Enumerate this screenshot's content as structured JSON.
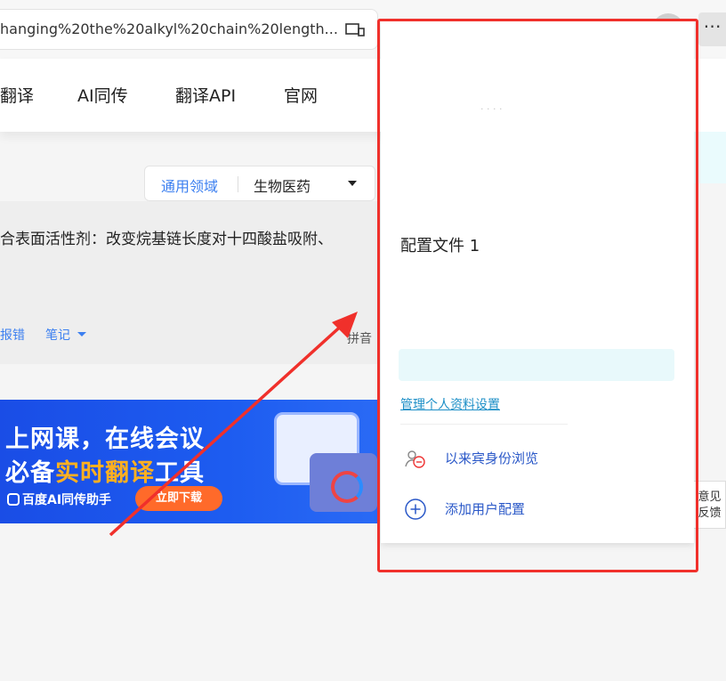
{
  "browser": {
    "url": "hanging%20the%20alkyl%20chain%20length..."
  },
  "site_nav": {
    "items": [
      "翻译",
      "AI同传",
      "翻译API",
      "官网"
    ]
  },
  "domain": {
    "general": "通用领域",
    "selected": "生物医药"
  },
  "source": {
    "text": "合表面活性剂：改变烷基链长度对十四酸盐吸附、",
    "report": "报错",
    "notes": "笔记",
    "pinyin": "拼音"
  },
  "banner": {
    "line1": "上网课，在线会议",
    "line2_pre": "必备",
    "line2_highlight": "实时翻译",
    "line2_post": "工具",
    "brand": "百度AI同传助手",
    "button": "立即下载"
  },
  "feedback": {
    "line1": "意见",
    "line2": "反馈"
  },
  "profile_panel": {
    "title": "配置文件 1",
    "manage_link": "管理个人资料设置",
    "guest": "以来宾身份浏览",
    "add_profile": "添加用户配置"
  },
  "colors": {
    "annotation": "#f0302b",
    "link": "#3b7ff0",
    "banner_bg": "#1d5cf0",
    "banner_button": "#ff6a2a"
  }
}
